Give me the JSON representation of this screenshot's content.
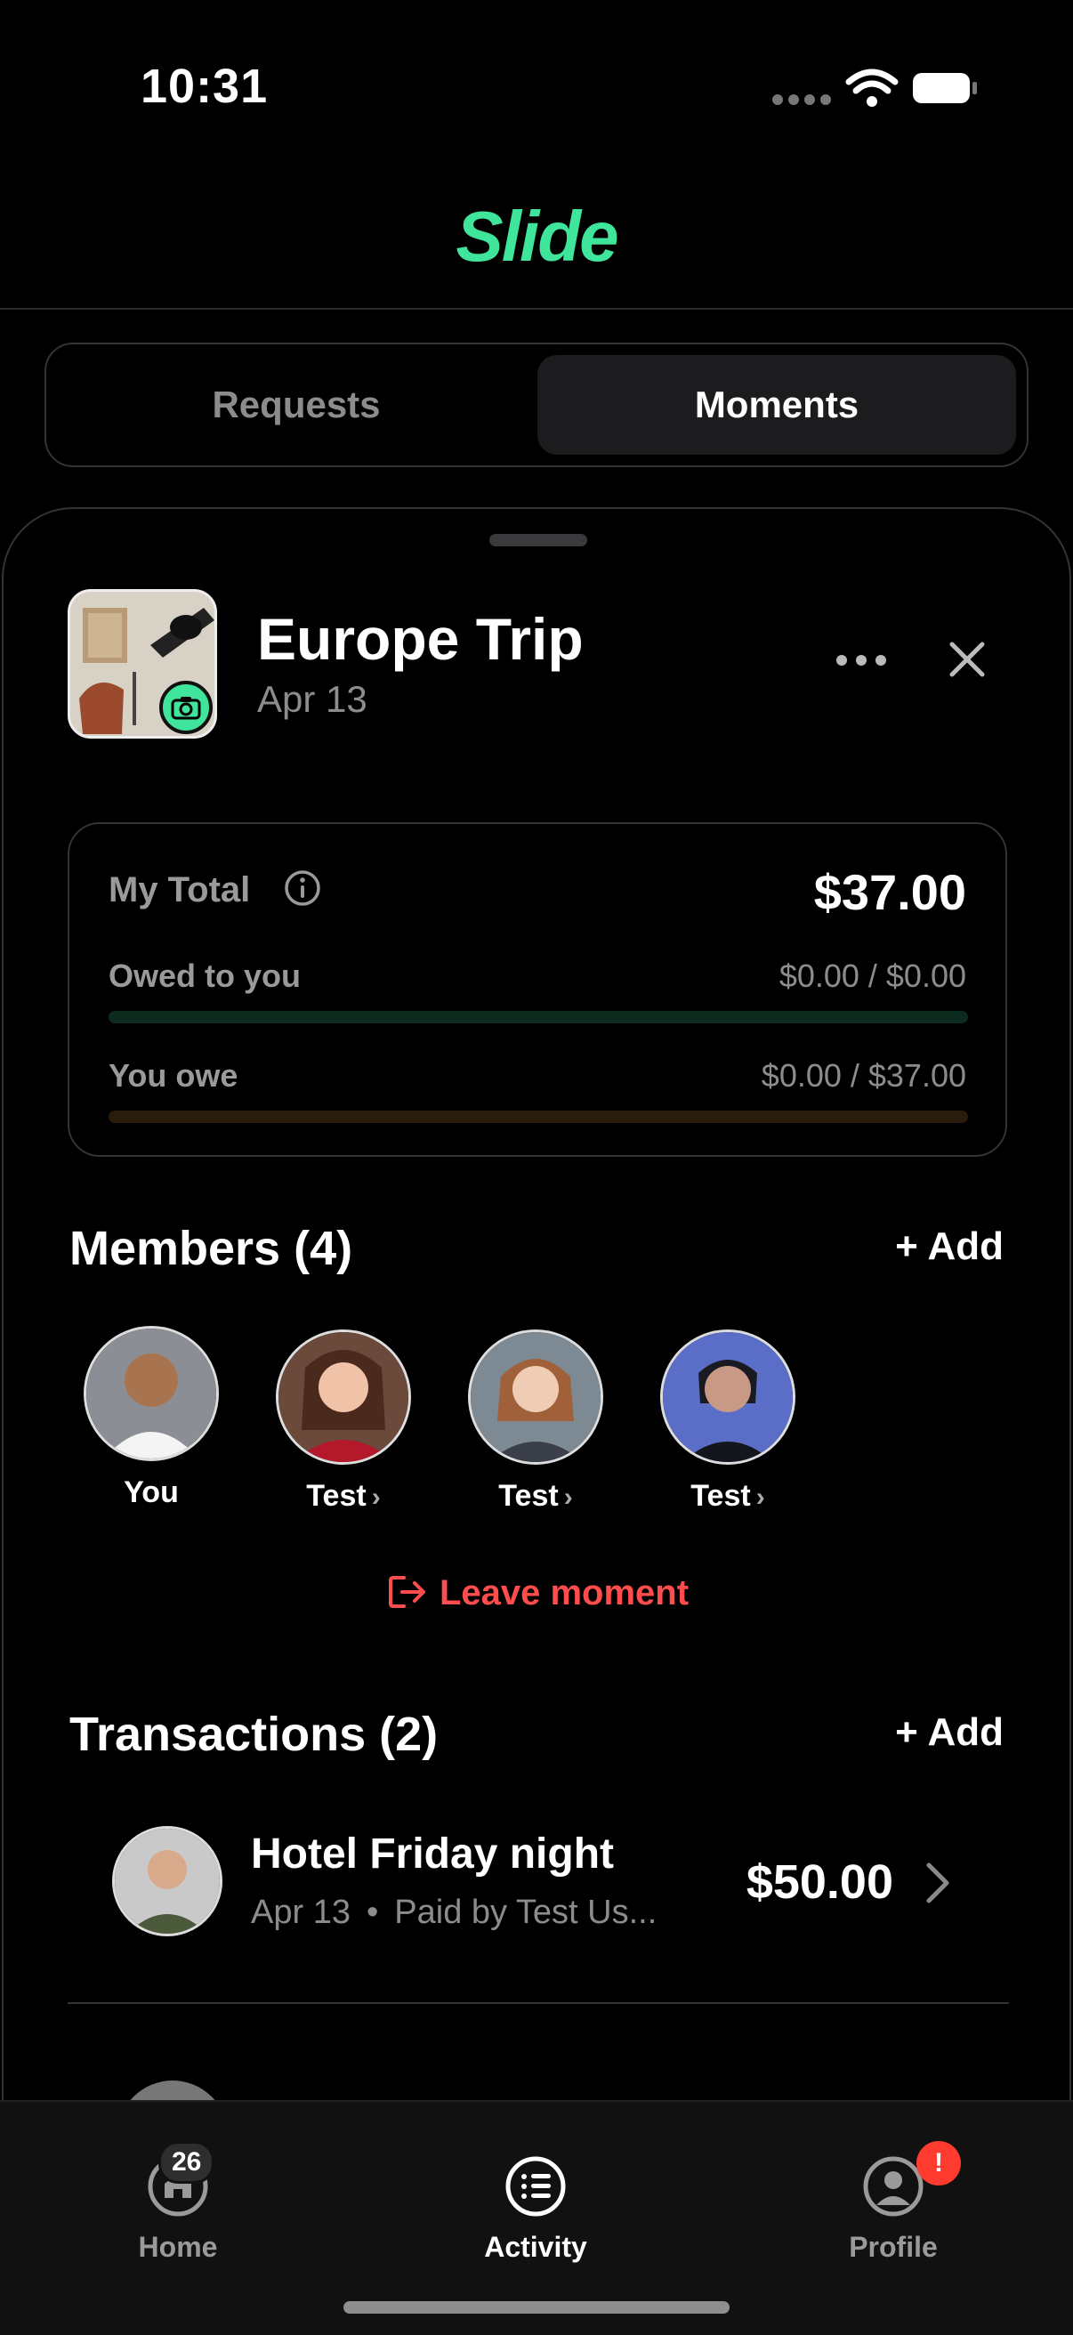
{
  "status": {
    "time": "10:31"
  },
  "app": {
    "logo": "Slide"
  },
  "segments": {
    "requests": "Requests",
    "moments": "Moments"
  },
  "moment": {
    "title": "Europe Trip",
    "date": "Apr 13"
  },
  "totals": {
    "label": "My Total",
    "amount": "$37.00",
    "owed_label": "Owed to you",
    "owed_value": "$0.00 / $0.00",
    "owe_label": "You owe",
    "owe_value": "$0.00 / $37.00"
  },
  "members": {
    "title": "Members (4)",
    "add": "+ Add",
    "list": [
      {
        "name": "You"
      },
      {
        "name": "Test"
      },
      {
        "name": "Test"
      },
      {
        "name": "Test"
      }
    ],
    "leave": "Leave moment"
  },
  "transactions": {
    "title": "Transactions (2)",
    "add": "+ Add",
    "items": [
      {
        "title": "Hotel Friday night",
        "date": "Apr 13",
        "paid_by": "Paid by Test Us...",
        "amount": "$50.00"
      }
    ]
  },
  "tabbar": {
    "home": "Home",
    "home_badge": "26",
    "activity": "Activity",
    "profile": "Profile",
    "profile_badge": "!"
  },
  "colors": {
    "accent": "#3ee59a",
    "danger": "#ff4d4d",
    "background": "#000000"
  }
}
